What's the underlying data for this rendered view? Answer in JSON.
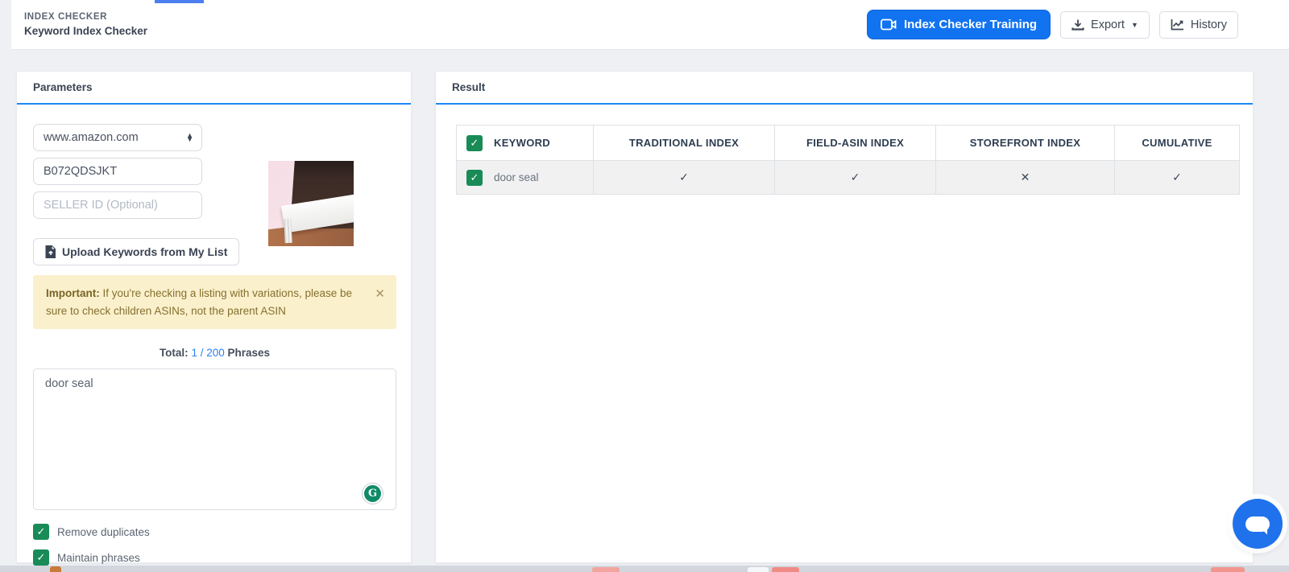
{
  "page": {
    "title_small": "INDEX CHECKER",
    "title_main": "Keyword Index Checker"
  },
  "header": {
    "training_button": "Index Checker Training",
    "export_button": "Export",
    "export_caret": "▼",
    "history_button": "History"
  },
  "parameters": {
    "panel_title": "Parameters",
    "marketplace_selected": "www.amazon.com",
    "asin_value": "B072QDSJKT",
    "seller_id_placeholder": "SELLER ID (Optional)",
    "upload_button": "Upload Keywords from My List",
    "warning_bold": "Important:",
    "warning_text": " If you're checking a listing with variations, please be sure to check children ASINs, not the parent ASIN",
    "warning_close": "✕",
    "total_label": "Total:",
    "total_count": "1 / 200",
    "total_suffix": "Phrases",
    "keywords_value": "door seal",
    "grammarly_letter": "G",
    "checkbox_glyph": "✓",
    "remove_duplicates_label": "Remove duplicates",
    "maintain_phrases_label": "Maintain phrases"
  },
  "result": {
    "panel_title": "Result",
    "table": {
      "columns": [
        "KEYWORD",
        "TRADITIONAL INDEX",
        "FIELD-ASIN INDEX",
        "STOREFRONT INDEX",
        "CUMULATIVE"
      ],
      "rows": [
        {
          "keyword": "door seal",
          "selected": "✓",
          "marks": [
            "✓",
            "✓",
            "✕",
            "✓"
          ]
        }
      ]
    }
  },
  "colors": {
    "accent_blue": "#1273f0",
    "panel_underline_blue": "#1d87f1",
    "checkbox_green": "#188b57",
    "warning_bg": "#fbf0cc",
    "warning_text": "#85702f",
    "link_blue": "#2f80ed",
    "chat_fab_blue": "#1f72ec"
  }
}
